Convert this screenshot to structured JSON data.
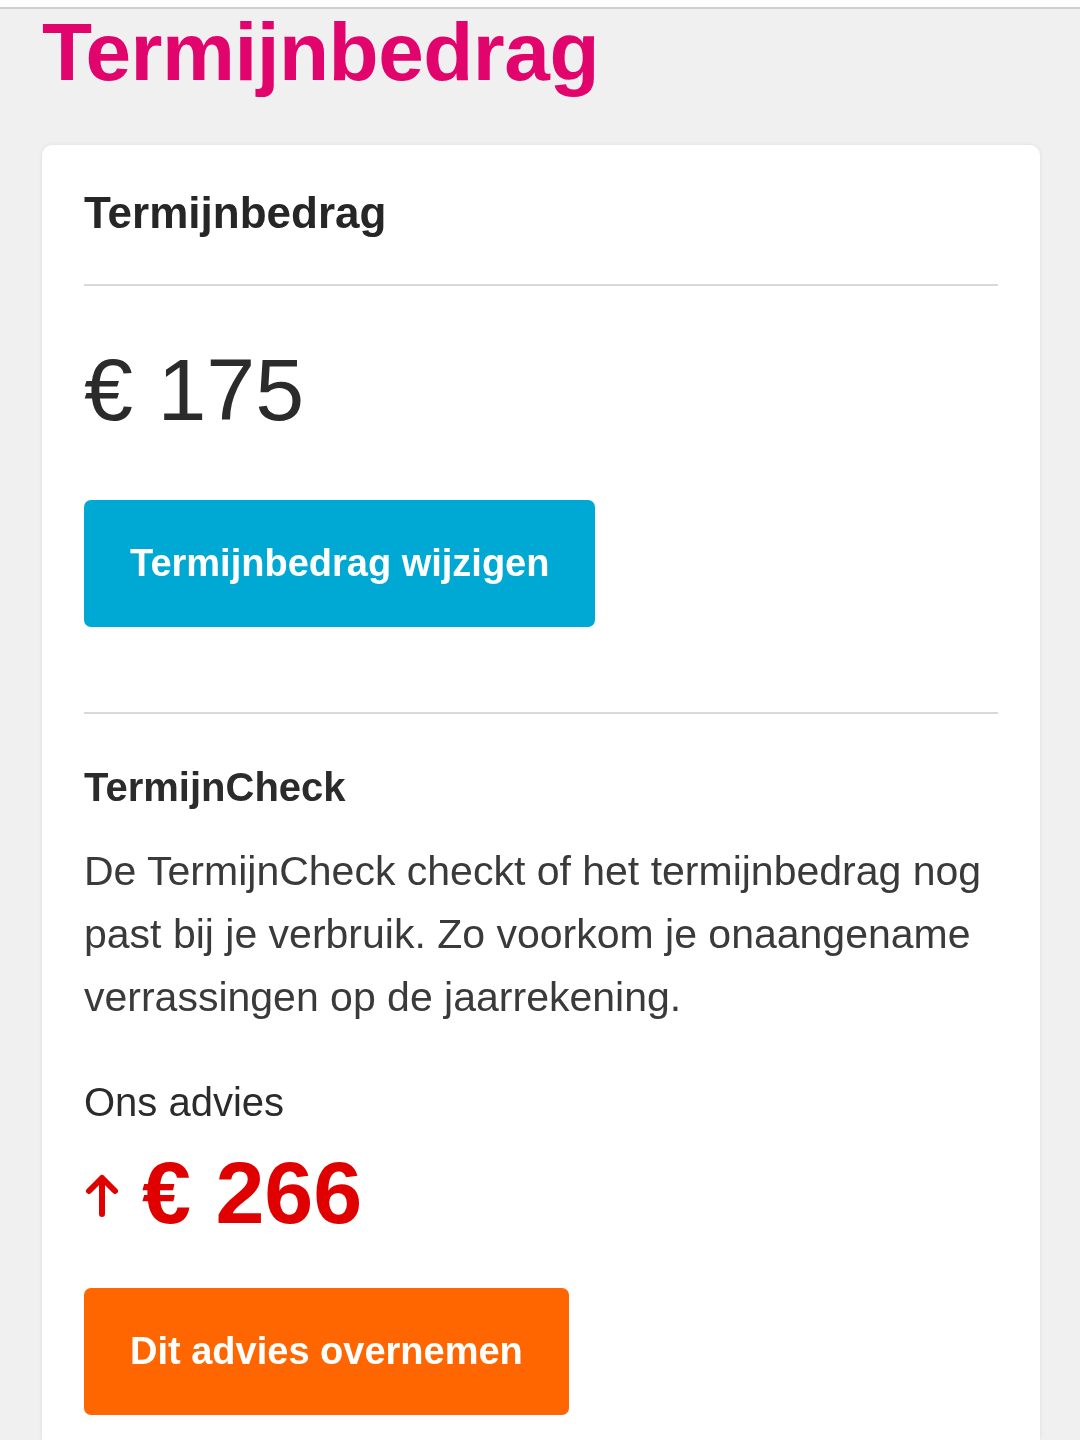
{
  "page_title": "Termijnbedrag",
  "card": {
    "heading": "Termijnbedrag",
    "amount": "€ 175",
    "change_button": "Termijnbedrag wijzigen",
    "check": {
      "heading": "TermijnCheck",
      "text": "De TermijnCheck checkt of het termijnbedrag nog past bij je verbruik. Zo voorkom je onaangename verrassingen op de jaarrekening.",
      "advice_label": "Ons advies",
      "advice": {
        "increase": true,
        "amount": "€ 266"
      },
      "accept_button": "Dit advies overnemen"
    }
  }
}
